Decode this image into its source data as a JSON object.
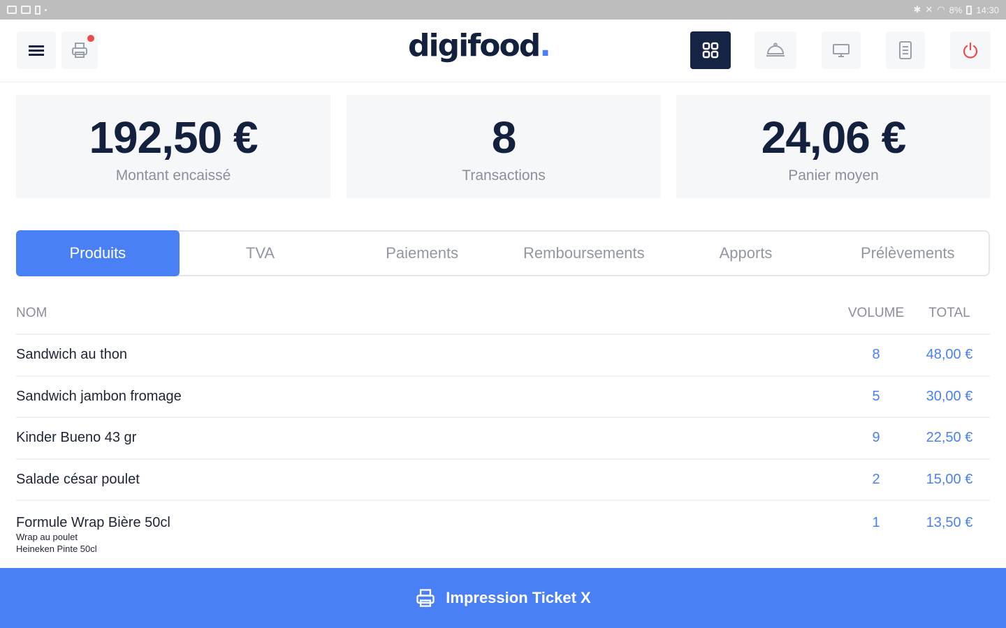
{
  "status_bar": {
    "time": "14:30",
    "battery": "8%"
  },
  "header": {
    "logo_text": "digifood",
    "logo_dot": ".",
    "left_icons": [
      "menu-icon",
      "printer-icon"
    ],
    "right_icons": [
      "grid-icon",
      "food-cloche-icon",
      "monitor-icon",
      "receipt-icon",
      "power-icon"
    ],
    "accent_color": "#4a80f6",
    "dark_color": "#152344",
    "alert_color": "#ef4b4b"
  },
  "kpis": [
    {
      "value": "192,50 €",
      "label": "Montant encaissé"
    },
    {
      "value": "8",
      "label": "Transactions"
    },
    {
      "value": "24,06 €",
      "label": "Panier moyen"
    }
  ],
  "tabs": [
    {
      "label": "Produits",
      "active": true
    },
    {
      "label": "TVA",
      "active": false
    },
    {
      "label": "Paiements",
      "active": false
    },
    {
      "label": "Remboursements",
      "active": false
    },
    {
      "label": "Apports",
      "active": false
    },
    {
      "label": "Prélèvements",
      "active": false
    }
  ],
  "table": {
    "headers": {
      "name": "NOM",
      "volume": "VOLUME",
      "total": "TOTAL"
    },
    "rows": [
      {
        "name": "Sandwich au thon",
        "volume": "8",
        "total": "48,00 €"
      },
      {
        "name": "Sandwich jambon fromage",
        "volume": "5",
        "total": "30,00 €"
      },
      {
        "name": "Kinder Bueno 43 gr",
        "volume": "9",
        "total": "22,50 €"
      },
      {
        "name": "Salade césar poulet",
        "volume": "2",
        "total": "15,00 €"
      },
      {
        "name": "Formule Wrap Bière 50cl",
        "volume": "1",
        "total": "13,50 €",
        "details": [
          "Wrap au poulet",
          "Heineken Pinte 50cl"
        ]
      }
    ]
  },
  "footer": {
    "label": "Impression Ticket X",
    "icon": "printer-icon"
  }
}
